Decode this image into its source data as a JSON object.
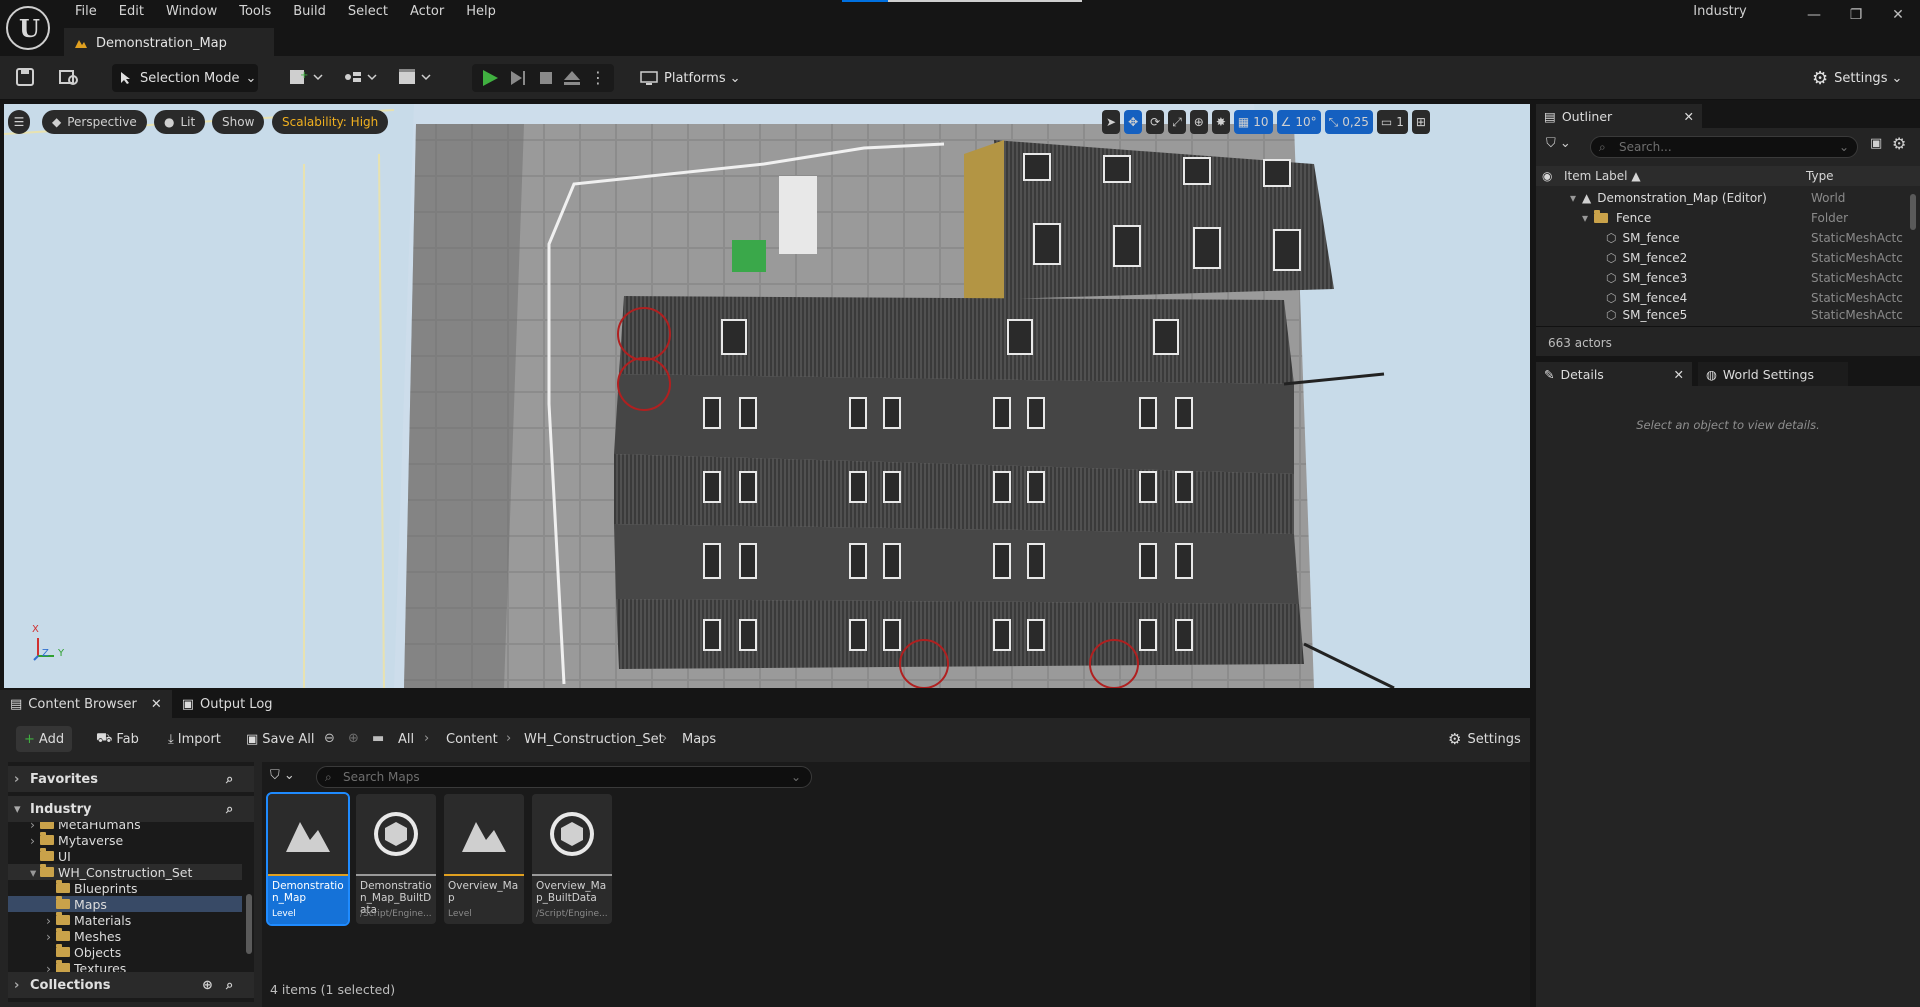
{
  "app": {
    "menus": [
      "File",
      "Edit",
      "Window",
      "Tools",
      "Build",
      "Select",
      "Actor",
      "Help"
    ],
    "level_tab": "Demonstration_Map",
    "project_name": "Industry",
    "window_controls": [
      "minimize-icon",
      "restore-icon",
      "close-icon"
    ]
  },
  "toolbar": {
    "selection_mode": "Selection Mode",
    "platforms": "Platforms",
    "settings": "Settings"
  },
  "viewport": {
    "perspective": "Perspective",
    "lit": "Lit",
    "show": "Show",
    "scalability": "Scalability: High",
    "grid_snap": "10",
    "rotation_snap": "10°",
    "scale_snap": "0,25",
    "camera_speed": "1",
    "axis_x": "X",
    "axis_y": "Y",
    "axis_z": "Z"
  },
  "outliner": {
    "tab": "Outliner",
    "search_placeholder": "Search...",
    "col_label": "Item Label",
    "col_type": "Type",
    "rows": [
      {
        "label": "Demonstration_Map (Editor)",
        "type": "World"
      },
      {
        "label": "Fence",
        "type": "Folder"
      },
      {
        "label": "SM_fence",
        "type": "StaticMeshActc"
      },
      {
        "label": "SM_fence2",
        "type": "StaticMeshActc"
      },
      {
        "label": "SM_fence3",
        "type": "StaticMeshActc"
      },
      {
        "label": "SM_fence4",
        "type": "StaticMeshActc"
      },
      {
        "label": "SM_fence5",
        "type": "StaticMeshActc"
      }
    ],
    "actor_count": "663 actors"
  },
  "details": {
    "tab": "Details",
    "world_settings_tab": "World Settings",
    "empty_message": "Select an object to view details."
  },
  "content_browser": {
    "tab": "Content Browser",
    "output_log_tab": "Output Log",
    "add": "Add",
    "fab": "Fab",
    "import": "Import",
    "save_all": "Save All",
    "breadcrumbs": [
      "All",
      "Content",
      "WH_Construction_Set",
      "Maps"
    ],
    "settings": "Settings",
    "favorites": "Favorites",
    "project_section": "Industry",
    "folders": [
      {
        "name": "MetaHumans",
        "depth": 1
      },
      {
        "name": "Mytaverse",
        "depth": 1
      },
      {
        "name": "UI",
        "depth": 1
      },
      {
        "name": "WH_Construction_Set",
        "depth": 1
      },
      {
        "name": "Blueprints",
        "depth": 2
      },
      {
        "name": "Maps",
        "depth": 2
      },
      {
        "name": "Materials",
        "depth": 2
      },
      {
        "name": "Meshes",
        "depth": 2
      },
      {
        "name": "Objects",
        "depth": 2
      },
      {
        "name": "Textures",
        "depth": 2
      }
    ],
    "collections": "Collections",
    "search_placeholder": "Search Maps",
    "assets": [
      {
        "name": "Demonstration_Map",
        "kind": "Level",
        "selected": true
      },
      {
        "name": "Demonstration_Map_BuiltData",
        "kind": "/Script/Engine...",
        "selected": false
      },
      {
        "name": "Overview_Map",
        "kind": "Level",
        "selected": false
      },
      {
        "name": "Overview_Map_BuiltData",
        "kind": "/Script/Engine...",
        "selected": false
      }
    ],
    "status": "4 items (1 selected)"
  },
  "colors": {
    "accent_blue": "#1572d8",
    "level_bar": "#e0a020",
    "builtdata_bar": "#9a9a9a",
    "scalability": "#f0b020",
    "play_green": "#40b040"
  }
}
